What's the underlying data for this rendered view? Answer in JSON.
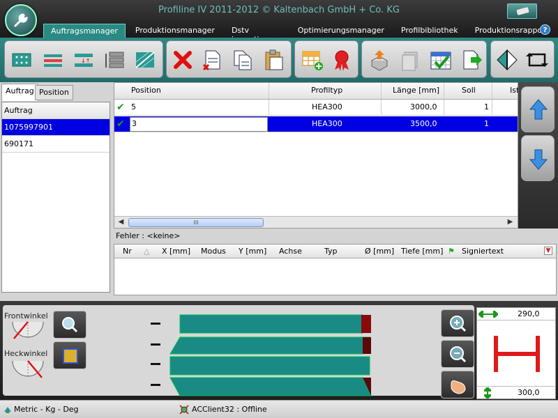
{
  "window": {
    "title": "Profiline IV 2011-2012 © Kaltenbach GmbH + Co. KG"
  },
  "tabs": [
    {
      "label": "Auftragsmanager",
      "active": true
    },
    {
      "label": "Produktionsmanager"
    },
    {
      "label": "Dstv importieren"
    },
    {
      "label": "Optimierungsmanager"
    },
    {
      "label": "Profilbibliothek"
    },
    {
      "label": "Produktionsrapport"
    }
  ],
  "help_label": "?",
  "left_panel": {
    "tabs": [
      "Auftrag",
      "Position"
    ],
    "header": "Auftrag",
    "items": [
      "1075997901",
      "690171"
    ]
  },
  "grid": {
    "columns": [
      "Position",
      "Profiltyp",
      "Länge [mm]",
      "Soll",
      "Ist"
    ],
    "rows": [
      {
        "position": "5",
        "profiltyp": "HEA300",
        "laenge": "3000,0",
        "soll": "1"
      },
      {
        "position": "3",
        "profiltyp": "HEA300",
        "laenge": "3500,0",
        "soll": "1"
      }
    ],
    "scroll_thumb": "III"
  },
  "errors": {
    "label": "Fehler : <keine>",
    "columns": [
      "Nr",
      "△",
      "X [mm]",
      "Modus",
      "Y [mm]",
      "Achse",
      "Typ",
      "Ø [mm]",
      "Tiefe [mm]",
      "Signiertext"
    ]
  },
  "bottom": {
    "front_label": "Frontwinkel",
    "rear_label": "Heckwinkel",
    "width_value": "290,0",
    "height_value": "300,0"
  },
  "status": {
    "units": "Metric - Kg - Deg",
    "client": "ACClient32 : Offline"
  },
  "colors": {
    "accent": "#2a8a83",
    "selection": "#0000e0",
    "profile": "#1a8a84",
    "profile_shape": "#e01a1a"
  }
}
